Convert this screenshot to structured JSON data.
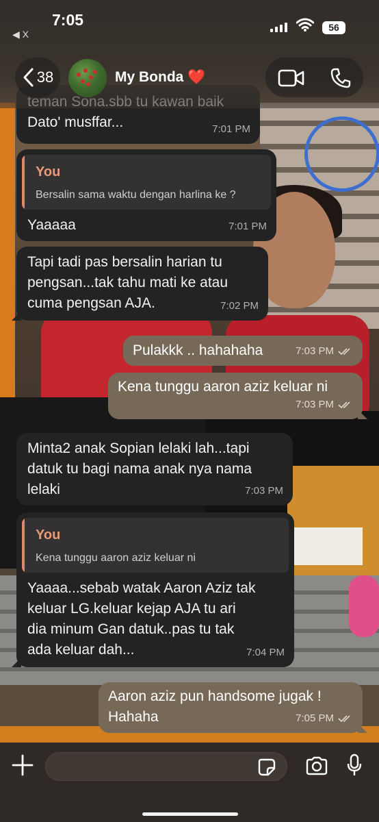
{
  "status_bar": {
    "time": "7:05",
    "back_app": "◀ X",
    "battery": "56"
  },
  "header": {
    "back_count": "38",
    "contact_name": "My Bonda ❤️",
    "icons": [
      "chevron-left-icon",
      "video-call-icon",
      "phone-icon"
    ]
  },
  "messages": [
    {
      "direction": "incoming",
      "text_line1": "teman Sona.sbb tu kawan baik",
      "text_line2": "Dato' musffar...",
      "time": "7:01 PM"
    },
    {
      "direction": "incoming",
      "quote_author": "You",
      "quote_text": "Bersalin sama waktu dengan harlina ke ?",
      "text": "Yaaaaa",
      "time": "7:01 PM"
    },
    {
      "direction": "incoming",
      "text_line1": "Tapi tadi pas bersalin harian tu",
      "text_line2": "pengsan...tak tahu mati ke atau",
      "text_line3": "cuma pengsan AJA.",
      "time": "7:02 PM"
    },
    {
      "direction": "outgoing",
      "text": "Pulakkk .. hahahaha",
      "time": "7:03 PM",
      "status": "read"
    },
    {
      "direction": "outgoing",
      "text": "Kena tunggu aaron aziz keluar ni",
      "time": "7:03 PM",
      "status": "read"
    },
    {
      "direction": "incoming",
      "text_line1": "Minta2 anak Sopian lelaki lah...tapi",
      "text_line2": "datuk tu bagi nama anak nya nama",
      "text_line3": "lelaki",
      "time": "7:03 PM"
    },
    {
      "direction": "incoming",
      "quote_author": "You",
      "quote_text": "Kena tunggu aaron aziz keluar ni",
      "text_line1": "Yaaaa...sebab watak Aaron Aziz tak",
      "text_line2": "keluar LG.keluar kejap AJA tu ari",
      "text_line3": "dia minum Gan datuk..pas tu tak",
      "text_line4": "ada keluar dah...",
      "time": "7:04 PM"
    },
    {
      "direction": "outgoing",
      "text_line1": "Aaron aziz pun handsome jugak !",
      "text_line2": "Hahaha",
      "time": "7:05 PM",
      "status": "read"
    }
  ],
  "input_bar": {
    "placeholder": "",
    "icons": [
      "plus-icon",
      "sticker-icon",
      "camera-icon",
      "microphone-icon"
    ]
  },
  "colors": {
    "incoming_bubble": "#232323",
    "outgoing_bubble": "#776957",
    "quote_accent": "#e0896a"
  }
}
